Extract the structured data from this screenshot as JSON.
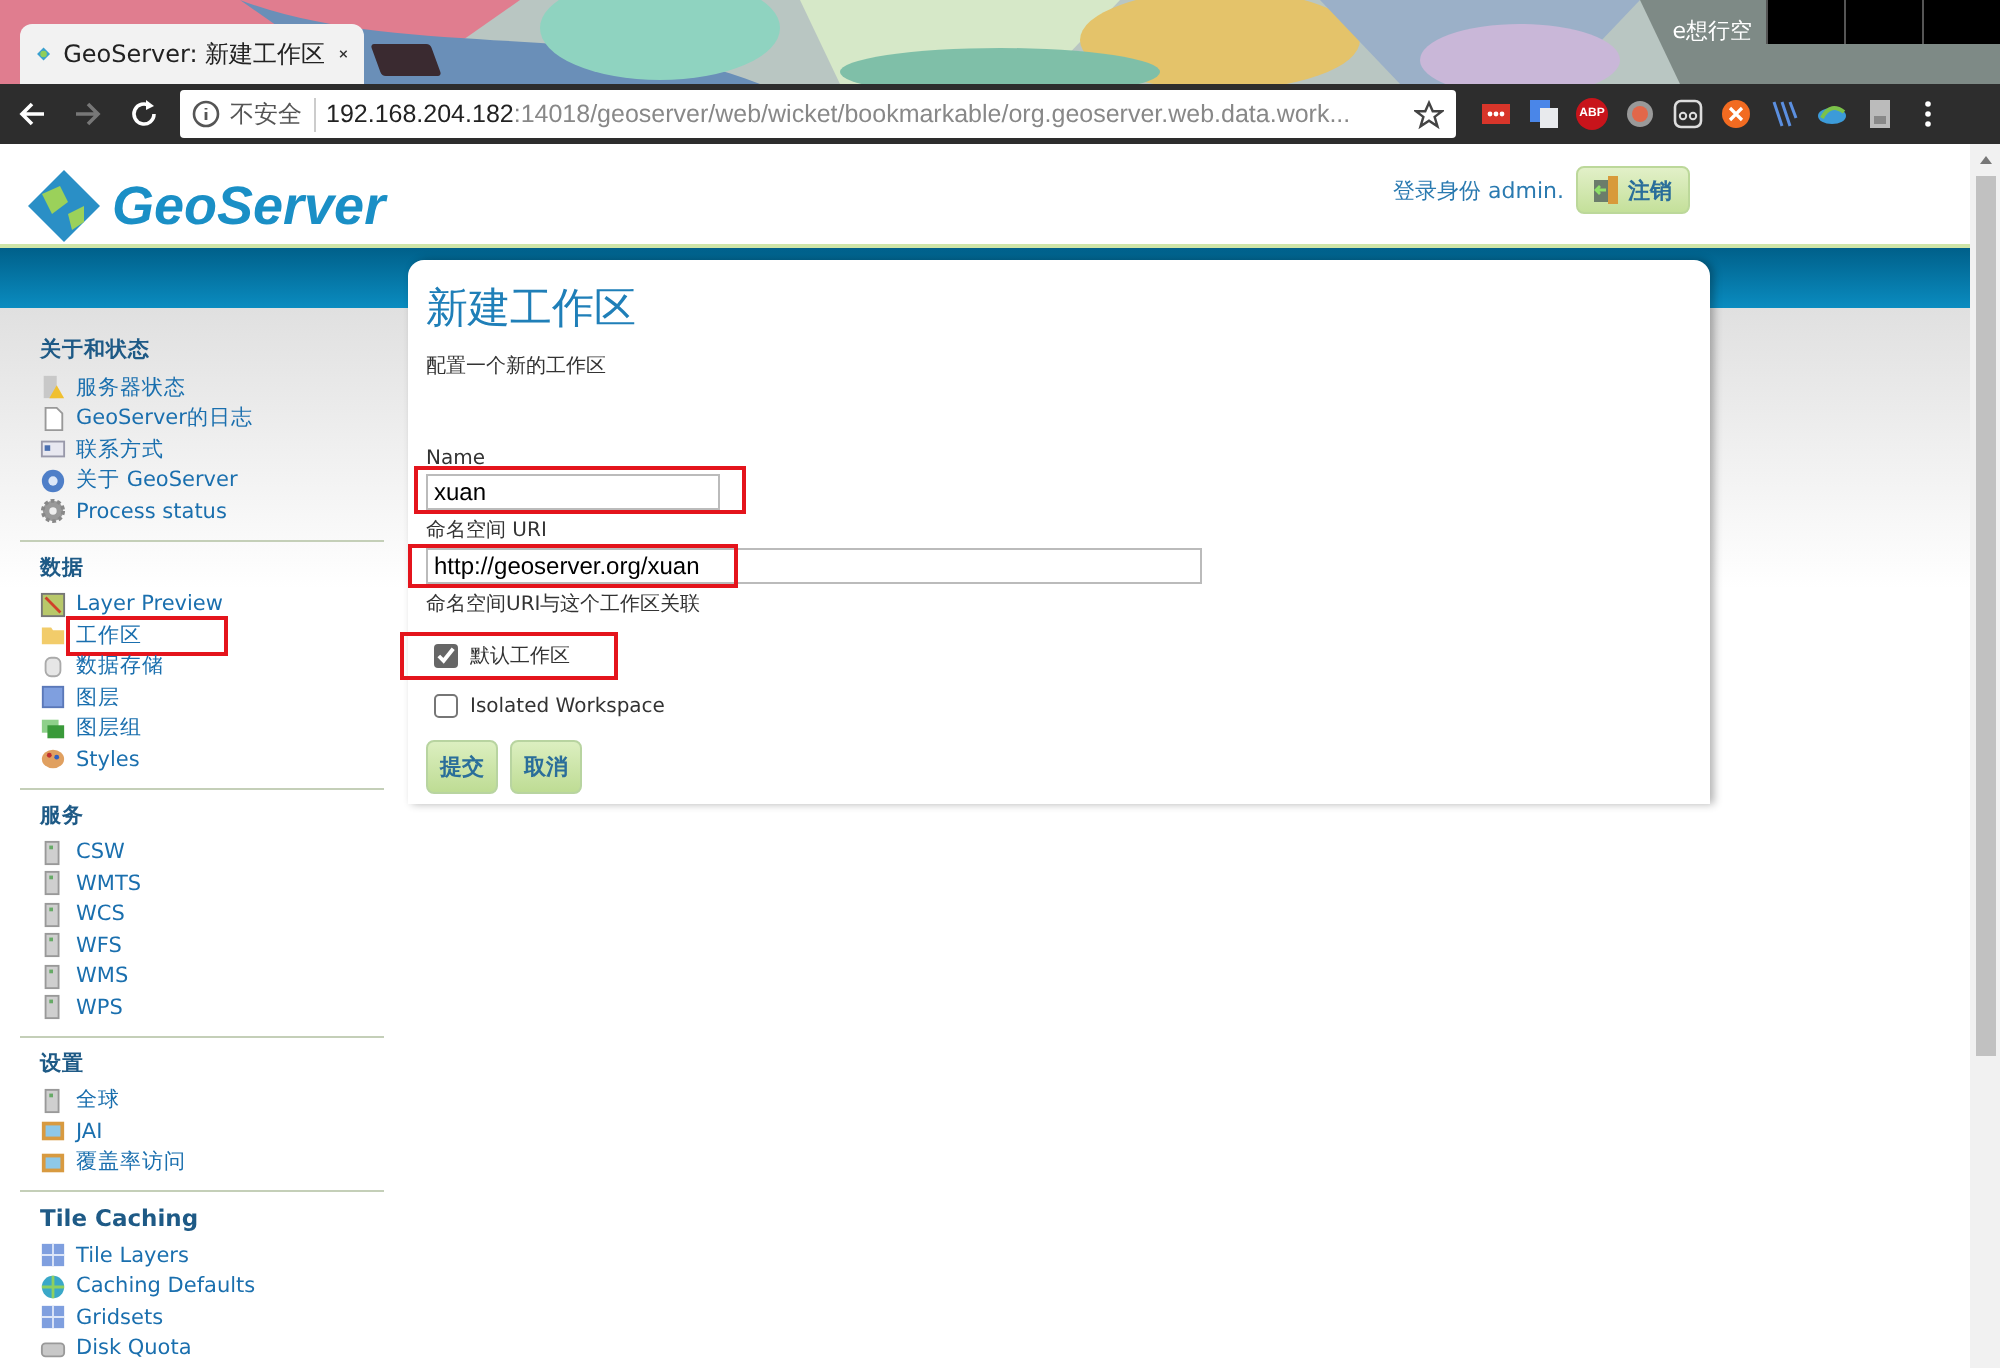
{
  "browser": {
    "tab_title": "GeoServer: 新建工作区",
    "profile_name": "e想行空",
    "security_label": "不安全",
    "url_host": "192.168.204.182",
    "url_rest": ":14018/geoserver/web/wicket/bookmarkable/org.geoserver.web.data.work...",
    "extension_badge": "ABP"
  },
  "header": {
    "logo_text": "GeoServer",
    "login_text": "登录身份 admin.",
    "logout_button": "注销"
  },
  "sidebar": [
    {
      "title": "关于和状态",
      "items": [
        {
          "label": "服务器状态",
          "highlighted": false
        },
        {
          "label": "GeoServer的日志",
          "highlighted": false
        },
        {
          "label": "联系方式",
          "highlighted": false
        },
        {
          "label": "关于 GeoServer",
          "highlighted": false
        },
        {
          "label": "Process status",
          "highlighted": false
        }
      ]
    },
    {
      "title": "数据",
      "items": [
        {
          "label": "Layer Preview",
          "highlighted": false
        },
        {
          "label": "工作区",
          "highlighted": true
        },
        {
          "label": "数据存储",
          "highlighted": false
        },
        {
          "label": "图层",
          "highlighted": false
        },
        {
          "label": "图层组",
          "highlighted": false
        },
        {
          "label": "Styles",
          "highlighted": false
        }
      ]
    },
    {
      "title": "服务",
      "items": [
        {
          "label": "CSW",
          "highlighted": false
        },
        {
          "label": "WMTS",
          "highlighted": false
        },
        {
          "label": "WCS",
          "highlighted": false
        },
        {
          "label": "WFS",
          "highlighted": false
        },
        {
          "label": "WMS",
          "highlighted": false
        },
        {
          "label": "WPS",
          "highlighted": false
        }
      ]
    },
    {
      "title": "设置",
      "items": [
        {
          "label": "全球",
          "highlighted": false
        },
        {
          "label": "JAI",
          "highlighted": false
        },
        {
          "label": "覆盖率访问",
          "highlighted": false
        }
      ]
    },
    {
      "title": "Tile Caching",
      "items": [
        {
          "label": "Tile Layers",
          "highlighted": false
        },
        {
          "label": "Caching Defaults",
          "highlighted": false
        },
        {
          "label": "Gridsets",
          "highlighted": false
        },
        {
          "label": "Disk Quota",
          "highlighted": false
        }
      ]
    }
  ],
  "form": {
    "title": "新建工作区",
    "description": "配置一个新的工作区",
    "name_label": "Name",
    "name_value": "xuan",
    "name_highlighted": true,
    "uri_label": "命名空间 URI",
    "uri_value": "http://geoserver.org/xuan",
    "uri_highlighted": true,
    "uri_hint": "命名空间URI与这个工作区关联",
    "checkboxes": [
      {
        "label": "默认工作区",
        "checked": true,
        "highlighted": true
      },
      {
        "label": "Isolated Workspace",
        "checked": false,
        "highlighted": false
      }
    ],
    "buttons": [
      "提交",
      "取消"
    ]
  }
}
